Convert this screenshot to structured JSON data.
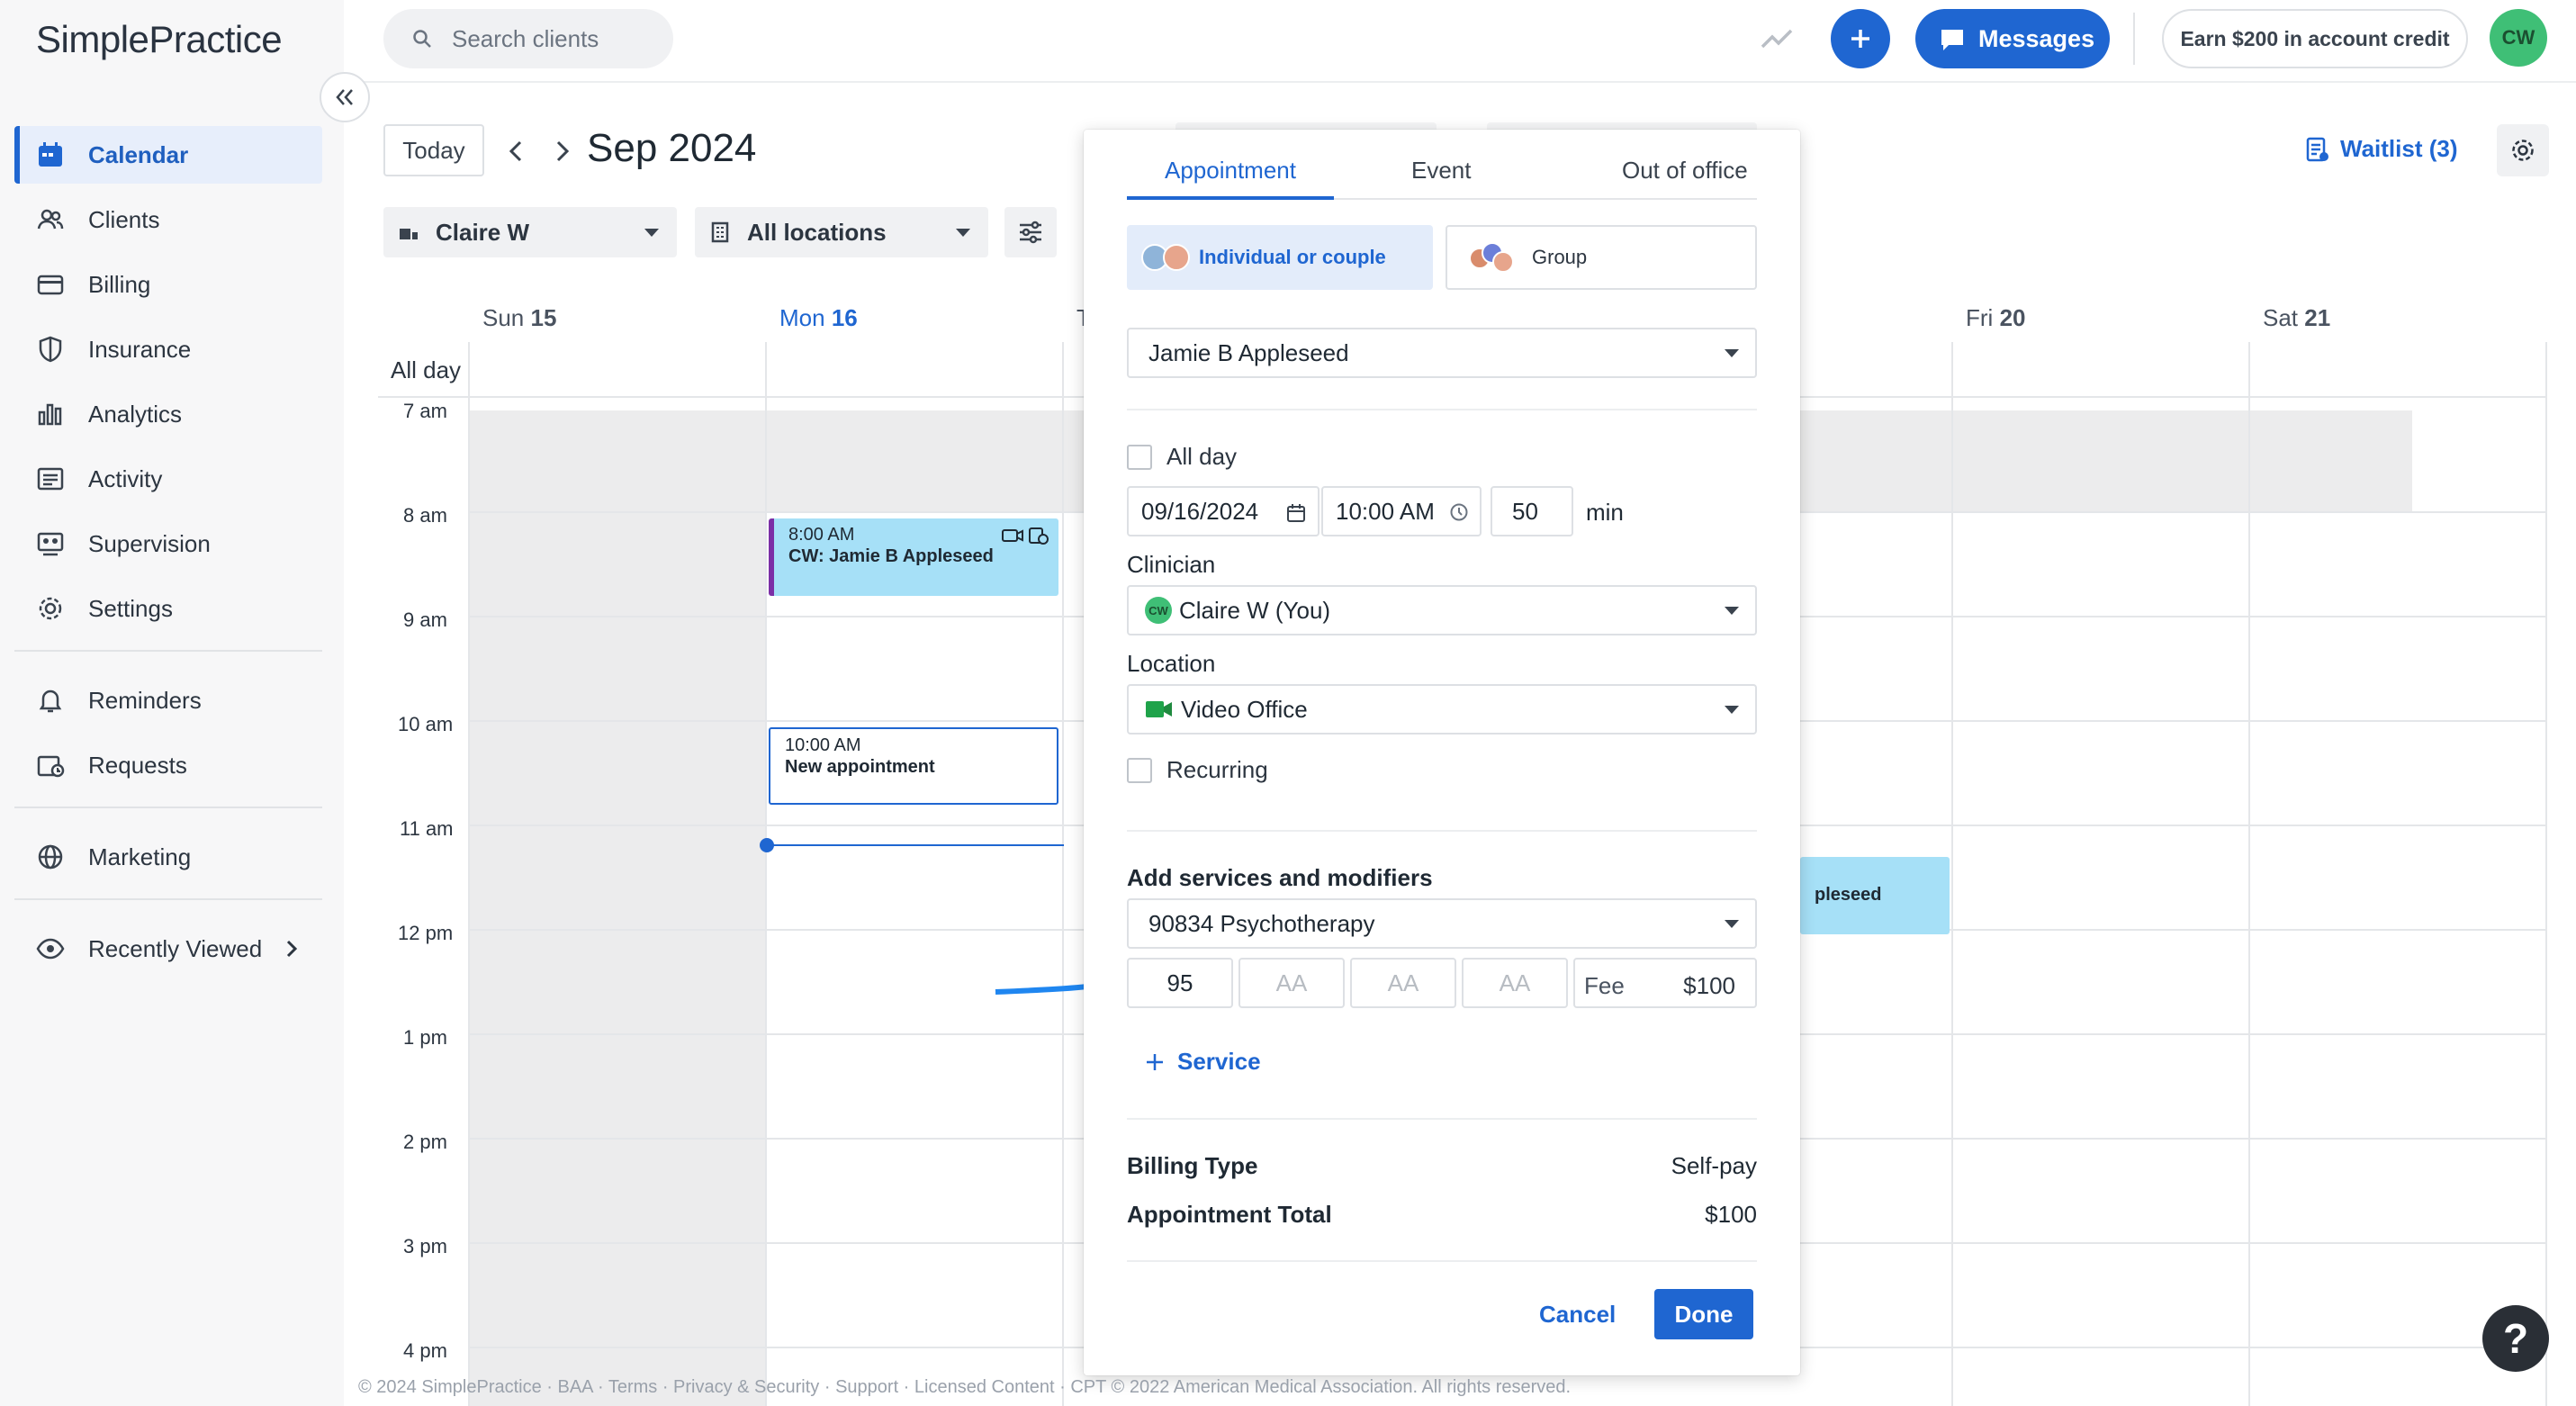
{
  "app": {
    "logo_text": "SimplePractice"
  },
  "sidebar": {
    "items": [
      {
        "label": "Calendar",
        "icon": "calendar-icon",
        "active": true
      },
      {
        "label": "Clients",
        "icon": "clients-icon"
      },
      {
        "label": "Billing",
        "icon": "billing-card-icon"
      },
      {
        "label": "Insurance",
        "icon": "shield-icon"
      },
      {
        "label": "Analytics",
        "icon": "bar-chart-icon"
      },
      {
        "label": "Activity",
        "icon": "list-icon"
      },
      {
        "label": "Supervision",
        "icon": "supervision-icon"
      },
      {
        "label": "Settings",
        "icon": "gear-icon"
      }
    ],
    "secondary": [
      {
        "label": "Reminders",
        "icon": "bell-icon"
      },
      {
        "label": "Requests",
        "icon": "requests-icon"
      }
    ],
    "tertiary": [
      {
        "label": "Marketing",
        "icon": "globe-icon"
      }
    ],
    "recently_viewed": {
      "label": "Recently Viewed",
      "icon": "eye-icon"
    }
  },
  "topbar": {
    "search_placeholder": "Search clients",
    "messages_label": "Messages",
    "credit_label": "Earn $200 in account credit",
    "avatar_initials": "CW"
  },
  "calendar": {
    "today_label": "Today",
    "month_title": "Sep 2024",
    "waitlist_label": "Waitlist (3)",
    "clinician_filter": "Claire W",
    "location_filter": "All locations",
    "allday_label": "All day",
    "days": [
      {
        "name": "Sun",
        "num": "15"
      },
      {
        "name": "Mon",
        "num": "16",
        "today": true
      },
      {
        "name": "T",
        "num": ""
      },
      {
        "name": "Fri",
        "num": "20"
      },
      {
        "name": "Sat",
        "num": "21"
      }
    ],
    "hours": [
      "7 am",
      "8 am",
      "9 am",
      "10 am",
      "11 am",
      "12 pm",
      "1 pm",
      "2 pm",
      "3 pm",
      "4 pm"
    ],
    "events": [
      {
        "time": "8:00 AM",
        "title": "CW: Jamie B Appleseed",
        "color": "#a6e0f7",
        "accent": "#7b2fa6"
      },
      {
        "time": "10:00 AM",
        "title": "New appointment",
        "color": "#ffffff",
        "accent": "#1f66d1"
      },
      {
        "time": "",
        "title": "pleseed",
        "color": "#a6e0f7",
        "accent": ""
      }
    ]
  },
  "modal": {
    "tabs": [
      "Appointment",
      "Event",
      "Out of office"
    ],
    "type_individual": "Individual or couple",
    "type_group": "Group",
    "client": "Jamie B Appleseed",
    "all_day_label": "All day",
    "date": "09/16/2024",
    "time": "10:00 AM",
    "duration": "50",
    "duration_unit": "min",
    "clinician_label": "Clinician",
    "clinician_initials": "CW",
    "clinician_value": "Claire W (You)",
    "location_label": "Location",
    "location_value": "Video Office",
    "recurring_label": "Recurring",
    "services_label": "Add services and modifiers",
    "service_value": "90834 Psychotherapy",
    "modifiers": [
      "95",
      "AA",
      "AA",
      "AA"
    ],
    "fee_label": "Fee",
    "fee_value": "$100",
    "add_service_label": "Service",
    "billing_type_label": "Billing Type",
    "billing_type_value": "Self-pay",
    "total_label": "Appointment Total",
    "total_value": "$100",
    "cancel_label": "Cancel",
    "done_label": "Done"
  },
  "footer": {
    "text": "© 2024 SimplePractice · BAA · Terms · Privacy & Security · Support · Licensed Content · CPT © 2022 American Medical Association. All rights reserved."
  },
  "help": {
    "label": "?"
  },
  "colors": {
    "accent": "#1f66d1",
    "avatar": "#3fbf76",
    "event_blue": "#a6e0f7",
    "event_border": "#7b2fa6"
  }
}
